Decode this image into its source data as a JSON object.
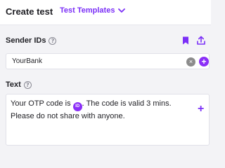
{
  "header": {
    "title": "Create test",
    "templates_label": "Test Templates"
  },
  "sender": {
    "label": "Sender IDs",
    "value": "YourBank",
    "bookmark_icon": "bookmark-icon",
    "upload_icon": "upload-icon"
  },
  "text": {
    "label": "Text",
    "before_token": "Your OTP code is ",
    "token": "ID",
    "after_token": ". The code is valid 3 mins. Please do not share with anyone."
  },
  "colors": {
    "accent": "#8b2ff7",
    "background": "#f3f3f6"
  }
}
